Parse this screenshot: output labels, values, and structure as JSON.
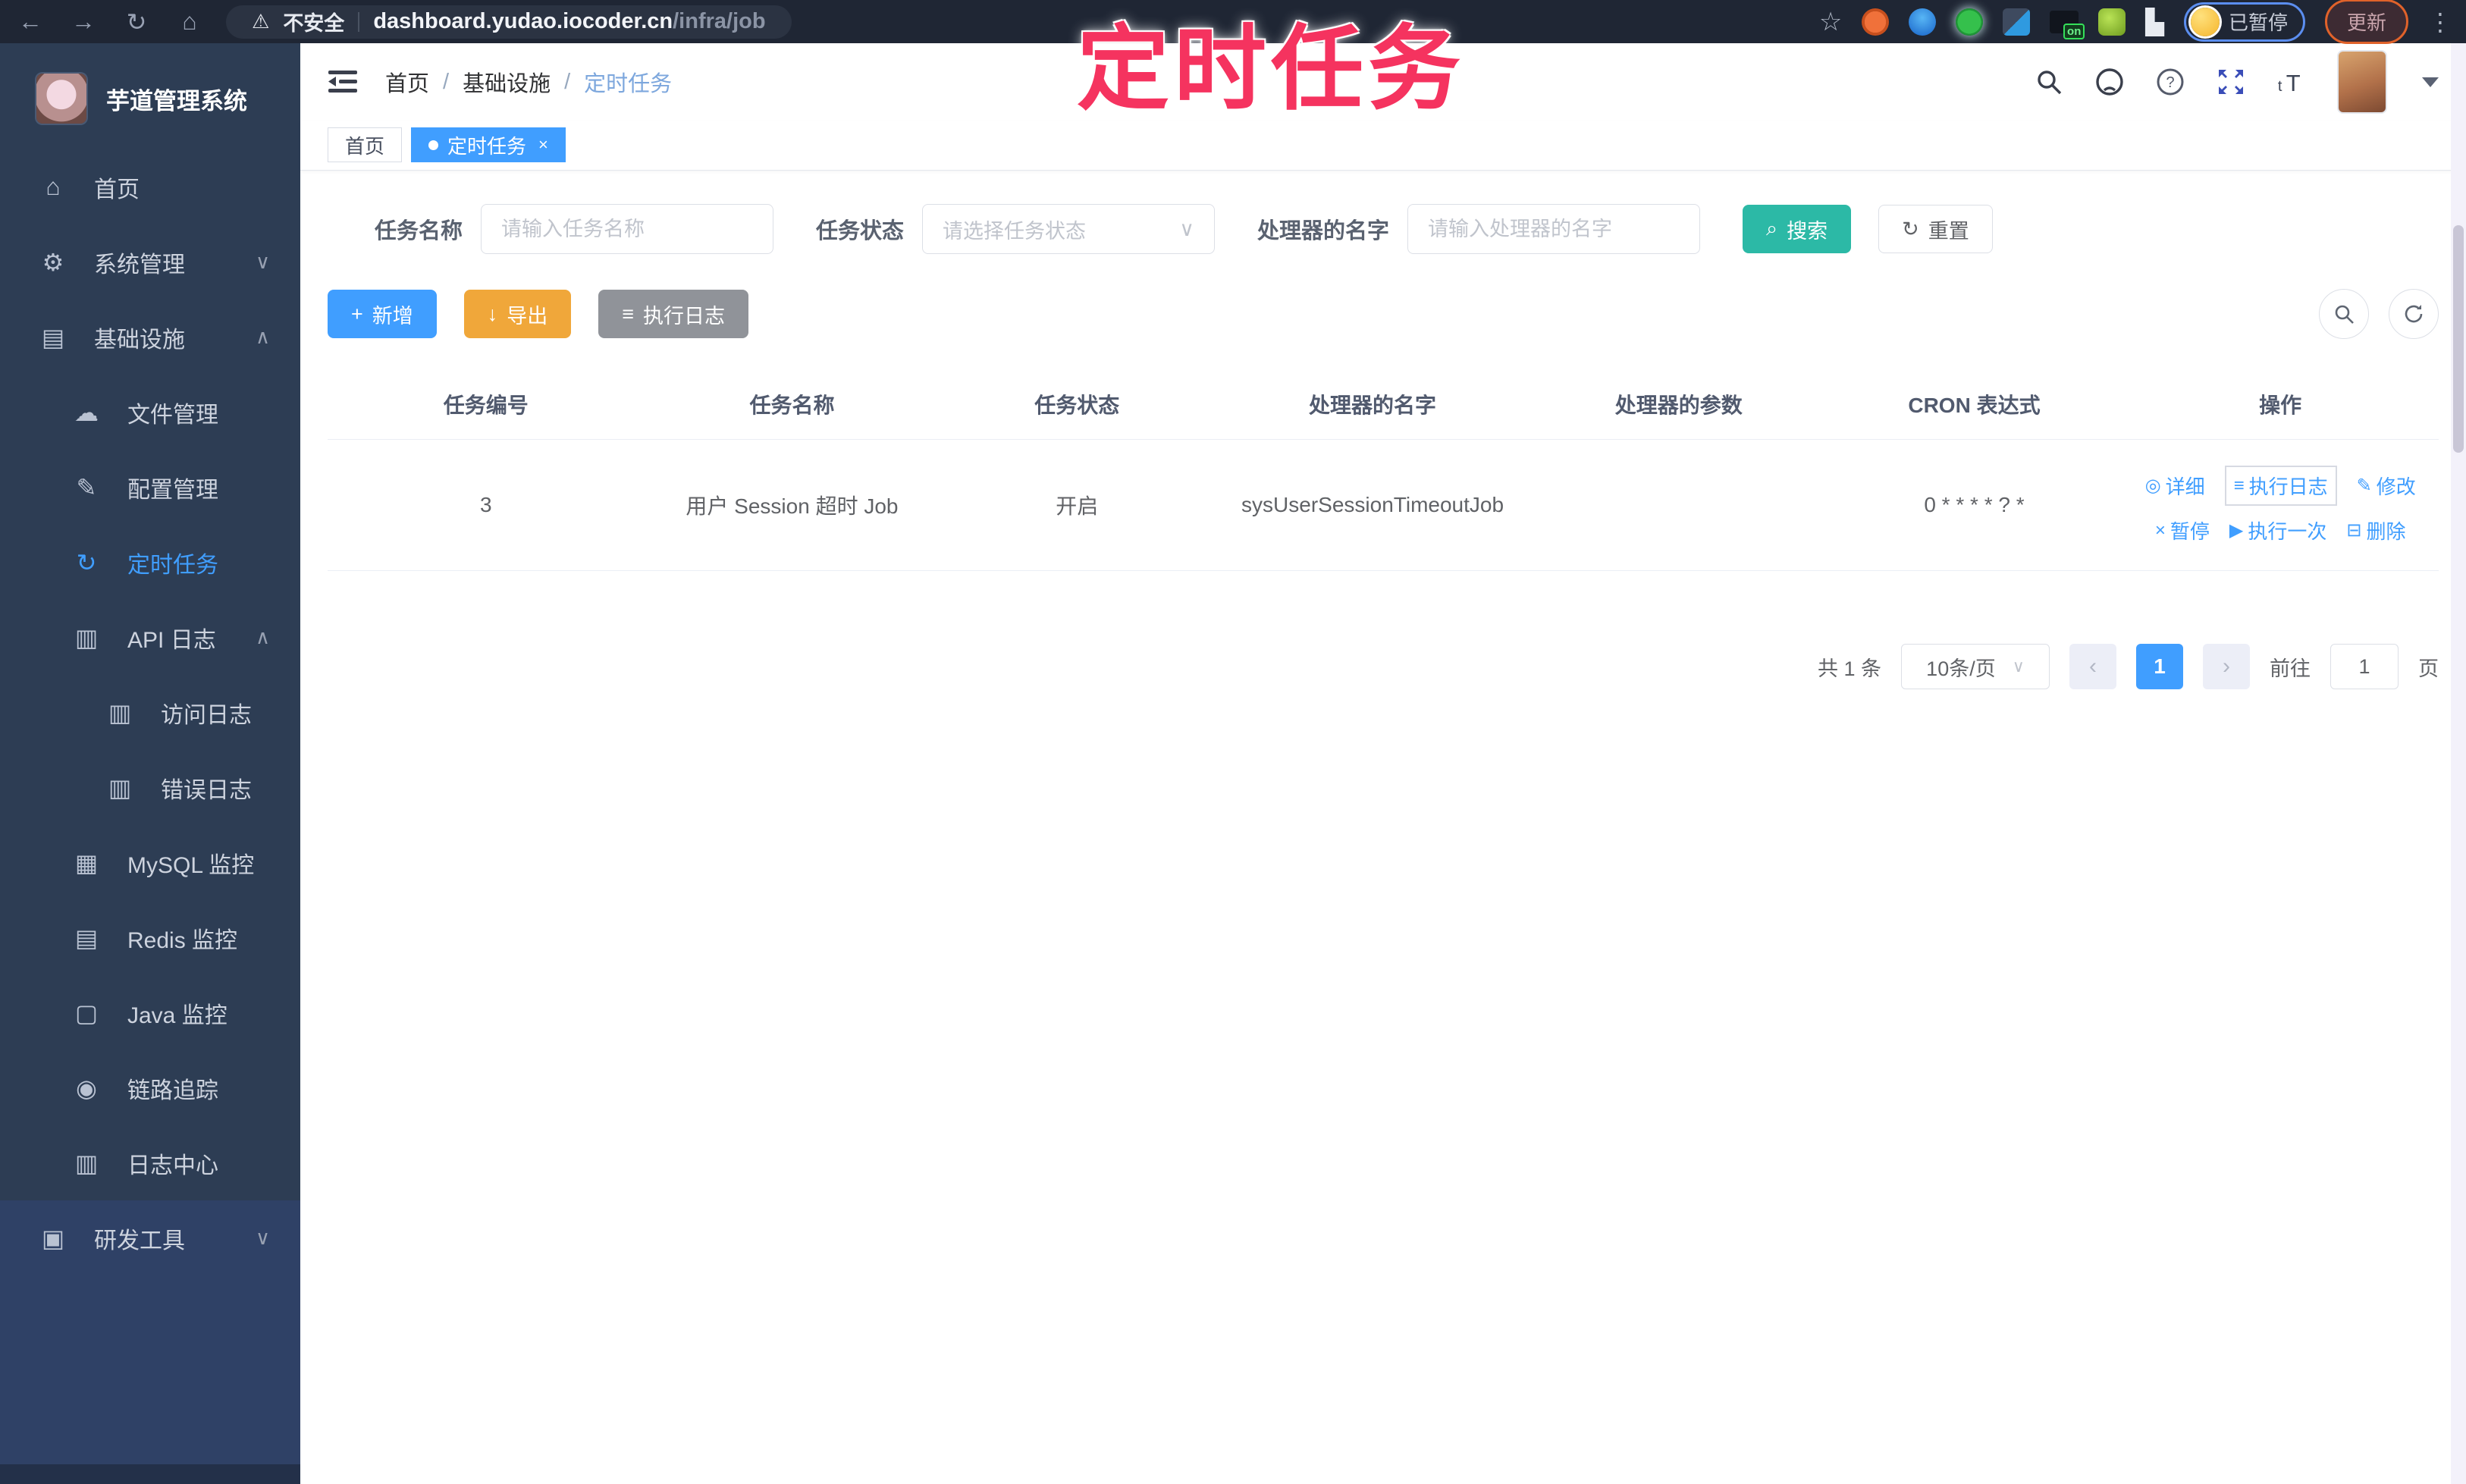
{
  "browser": {
    "back_icon": "←",
    "forward_icon": "→",
    "reload_icon": "↻",
    "home_icon": "⌂",
    "warning_icon": "⚠",
    "security_label": "不安全",
    "url_host": "dashboard.yudao.iocoder.cn",
    "url_path": "/infra/job",
    "star_icon": "☆",
    "puzzle_icon": "▙",
    "kebab_icon": "⋮",
    "on_badge": "on",
    "paused_badge": "已暂停",
    "update_button": "更新"
  },
  "overlay_title": "定时任务",
  "sidebar": {
    "app_title": "芋道管理系统",
    "items": [
      {
        "label": "首页",
        "glyph": "⌂",
        "level": 0
      },
      {
        "label": "系统管理",
        "glyph": "⚙",
        "level": 0,
        "chevron": "∨"
      },
      {
        "label": "基础设施",
        "glyph": "▤",
        "level": 0,
        "chevron": "∧"
      },
      {
        "label": "文件管理",
        "glyph": "☁",
        "level": 1
      },
      {
        "label": "配置管理",
        "glyph": "✎",
        "level": 1
      },
      {
        "label": "定时任务",
        "glyph": "↻",
        "level": 1,
        "active": true
      },
      {
        "label": "API 日志",
        "glyph": "▥",
        "level": 1,
        "chevron": "∧"
      },
      {
        "label": "访问日志",
        "glyph": "▥",
        "level": 2
      },
      {
        "label": "错误日志",
        "glyph": "▥",
        "level": 2
      },
      {
        "label": "MySQL 监控",
        "glyph": "▦",
        "level": 1
      },
      {
        "label": "Redis 监控",
        "glyph": "▤",
        "level": 1
      },
      {
        "label": "Java 监控",
        "glyph": "▢",
        "level": 1
      },
      {
        "label": "链路追踪",
        "glyph": "◉",
        "level": 1
      },
      {
        "label": "日志中心",
        "glyph": "▥",
        "level": 1
      },
      {
        "label": "研发工具",
        "glyph": "▣",
        "level": 0,
        "chevron": "∨"
      }
    ]
  },
  "header": {
    "breadcrumb": {
      "0": "首页",
      "1": "基础设施",
      "2": "定时任务"
    },
    "separator": "/"
  },
  "tabs": {
    "0": {
      "label": "首页"
    },
    "1": {
      "label": "定时任务",
      "close": "×"
    }
  },
  "filters": {
    "name_label": "任务名称",
    "name_placeholder": "请输入任务名称",
    "status_label": "任务状态",
    "status_placeholder": "请选择任务状态",
    "status_chevron": "∨",
    "handler_label": "处理器的名字",
    "handler_placeholder": "请输入处理器的名字",
    "search_label": "搜索",
    "search_glyph": "⌕",
    "reset_label": "重置",
    "reset_glyph": "↻"
  },
  "toolbar": {
    "add_label": "新增",
    "add_glyph": "+",
    "export_label": "导出",
    "export_glyph": "↓",
    "log_label": "执行日志",
    "log_glyph": "≡"
  },
  "table": {
    "columns": {
      "0": "任务编号",
      "1": "任务名称",
      "2": "任务状态",
      "3": "处理器的名字",
      "4": "处理器的参数",
      "5": "CRON 表达式",
      "6": "操作"
    },
    "row": {
      "id": "3",
      "name": "用户 Session 超时 Job",
      "status": "开启",
      "handler": "sysUserSessionTimeoutJob",
      "param": "",
      "cron": "0 * * * * ? *"
    },
    "actions": {
      "detail": "详细",
      "detail_glyph": "◎",
      "run_log": "执行日志",
      "run_log_glyph": "≡",
      "edit": "修改",
      "edit_glyph": "✎",
      "pause": "暂停",
      "pause_glyph": "×",
      "run_once": "执行一次",
      "run_once_glyph": "▶",
      "delete": "删除",
      "delete_glyph": "⊟"
    }
  },
  "pagination": {
    "total": "共 1 条",
    "page_size": "10条/页",
    "size_chevron": "∨",
    "prev": "‹",
    "next": "›",
    "page": "1",
    "goto_label": "前往",
    "goto_value": "1",
    "page_label": "页"
  },
  "colors": {
    "primary": "#409EFF",
    "teal": "#2cb9a6",
    "warning": "#f0a73a",
    "info": "#909399",
    "sidebar_bg": "#2d3d54",
    "annotation": "#f5335f"
  }
}
